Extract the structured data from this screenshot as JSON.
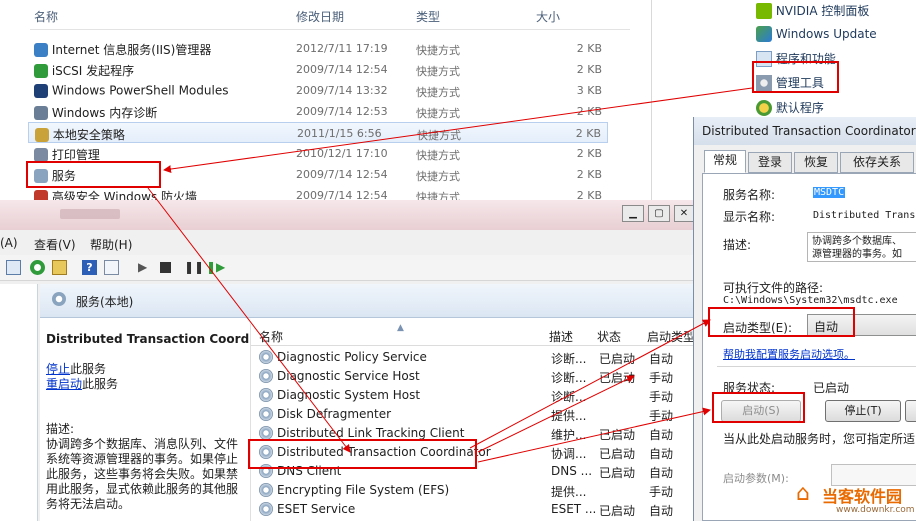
{
  "explorer": {
    "columns": {
      "name": "名称",
      "date": "修改日期",
      "type": "类型",
      "size": "大小"
    },
    "rows": [
      {
        "name": "Internet 信息服务(IIS)管理器",
        "date": "2012/7/11 17:19",
        "type": "快捷方式",
        "size": "2 KB",
        "icon": "iis-icon"
      },
      {
        "name": "iSCSI 发起程序",
        "date": "2009/7/14 12:54",
        "type": "快捷方式",
        "size": "2 KB",
        "icon": "globe-icon"
      },
      {
        "name": "Windows PowerShell Modules",
        "date": "2009/7/14 13:32",
        "type": "快捷方式",
        "size": "3 KB",
        "icon": "powershell-icon"
      },
      {
        "name": "Windows 内存诊断",
        "date": "2009/7/14 12:53",
        "type": "快捷方式",
        "size": "2 KB",
        "icon": "memory-icon"
      },
      {
        "name": "本地安全策略",
        "date": "2011/1/15 6:56",
        "type": "快捷方式",
        "size": "2 KB",
        "icon": "security-policy-icon"
      },
      {
        "name": "打印管理",
        "date": "2010/12/1 17:10",
        "type": "快捷方式",
        "size": "2 KB",
        "icon": "printer-icon"
      },
      {
        "name": "服务",
        "date": "2009/7/14 12:54",
        "type": "快捷方式",
        "size": "2 KB",
        "icon": "gear-icon"
      },
      {
        "name": "高级安全 Windows 防火墙",
        "date": "2009/7/14 12:54",
        "type": "快捷方式",
        "size": "2 KB",
        "icon": "firewall-icon"
      }
    ]
  },
  "control_panel": {
    "items": [
      "NVIDIA 控制面板",
      "Windows Update",
      "程序和功能",
      "管理工具",
      "默认程序"
    ]
  },
  "services_window": {
    "menu": [
      "(A)",
      "查看(V)",
      "帮助(H)"
    ],
    "pane_title": "服务(本地)",
    "selected_service_name": "Distributed Transaction Coordinator",
    "stop_link": "停止",
    "stop_suffix": "此服务",
    "restart_link": "重启动",
    "restart_suffix": "此服务",
    "desc_label": "描述:",
    "desc_lines": [
      "协调跨多个数据库、消息队列、文件",
      "系统等资源管理器的事务。如果停止",
      "此服务，这些事务将会失败。如果禁",
      "用此服务，显式依赖此服务的其他服",
      "务将无法启动。"
    ],
    "list_columns": {
      "name": "名称",
      "desc": "描述",
      "status": "状态",
      "startup": "启动类型"
    },
    "list_rows": [
      {
        "name": "Diagnostic Policy Service",
        "desc": "诊断...",
        "status": "已启动",
        "startup": "自动"
      },
      {
        "name": "Diagnostic Service Host",
        "desc": "诊断...",
        "status": "已启动",
        "startup": "手动"
      },
      {
        "name": "Diagnostic System Host",
        "desc": "诊断...",
        "status": "",
        "startup": "手动"
      },
      {
        "name": "Disk Defragmenter",
        "desc": "提供...",
        "status": "",
        "startup": "手动"
      },
      {
        "name": "Distributed Link Tracking Client",
        "desc": "维护...",
        "status": "已启动",
        "startup": "自动"
      },
      {
        "name": "Distributed Transaction Coordinator",
        "desc": "协调...",
        "status": "已启动",
        "startup": "自动"
      },
      {
        "name": "DNS Client",
        "desc": "DNS ...",
        "status": "已启动",
        "startup": "自动"
      },
      {
        "name": "Encrypting File System (EFS)",
        "desc": "提供...",
        "status": "",
        "startup": "手动"
      },
      {
        "name": "ESET Service",
        "desc": "ESET ...",
        "status": "已启动",
        "startup": "自动"
      }
    ]
  },
  "dialog": {
    "title": "Distributed Transaction Coordinator 的",
    "tabs": [
      "常规",
      "登录",
      "恢复",
      "依存关系"
    ],
    "service_name_label": "服务名称:",
    "service_name_value": "MSDTC",
    "display_name_label": "显示名称:",
    "display_name_value": "Distributed Trans",
    "desc_label": "描述:",
    "desc_value_lines": [
      "协调跨多个数据库、",
      "源管理器的事务。如"
    ],
    "path_label": "可执行文件的路径:",
    "path_value": "C:\\Windows\\System32\\msdtc.exe",
    "startup_type_label": "启动类型(E):",
    "startup_type_value": "自动",
    "help_link": "帮助我配置服务启动选项。",
    "status_label": "服务状态:",
    "status_value": "已启动",
    "start_button": "启动(S)",
    "stop_button": "停止(T)",
    "start_params_hint": "当从此处启动服务时，您可指定所适",
    "start_params_label": "启动参数(M):"
  },
  "watermark": {
    "name": "当客软件园",
    "url": "www.downkr.com"
  }
}
